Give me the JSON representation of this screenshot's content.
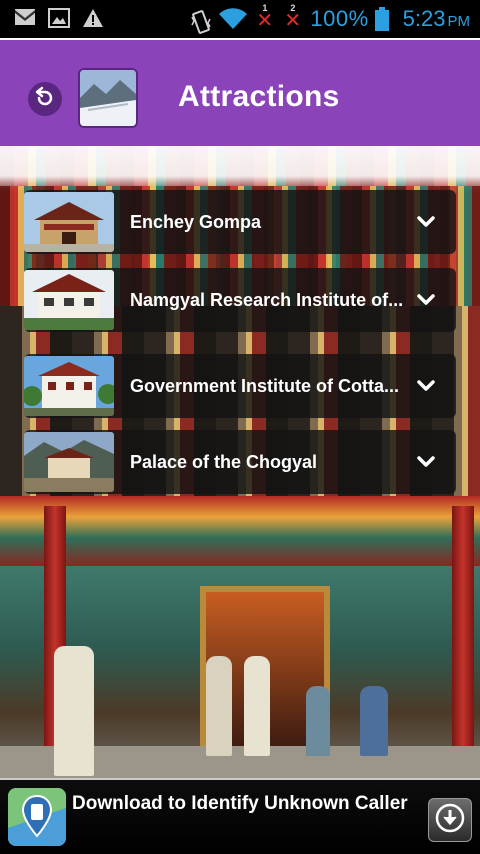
{
  "status_bar": {
    "battery_text": "100%",
    "time": "5:23",
    "ampm": "PM",
    "sim1_number": "1",
    "sim2_number": "2",
    "icons": [
      "gmail-icon",
      "gallery-icon",
      "warning-icon",
      "vibrate-icon",
      "wifi-icon",
      "no-signal-icon",
      "battery-icon"
    ]
  },
  "header": {
    "title": "Attractions",
    "back_icon": "back-arrow-icon"
  },
  "attractions": [
    {
      "label": "Enchey Gompa"
    },
    {
      "label": "Namgyal Research Institute of..."
    },
    {
      "label": "Government Institute of Cotta..."
    },
    {
      "label": "Palace of the Chogyal"
    }
  ],
  "ad": {
    "text": "Download to Identify Unknown Caller"
  },
  "colors": {
    "header_bg": "#8a43b9",
    "back_button_bg": "#5a2780",
    "status_accent": "#2ba0e0",
    "item_bg": "rgba(20,20,20,0.82)"
  }
}
